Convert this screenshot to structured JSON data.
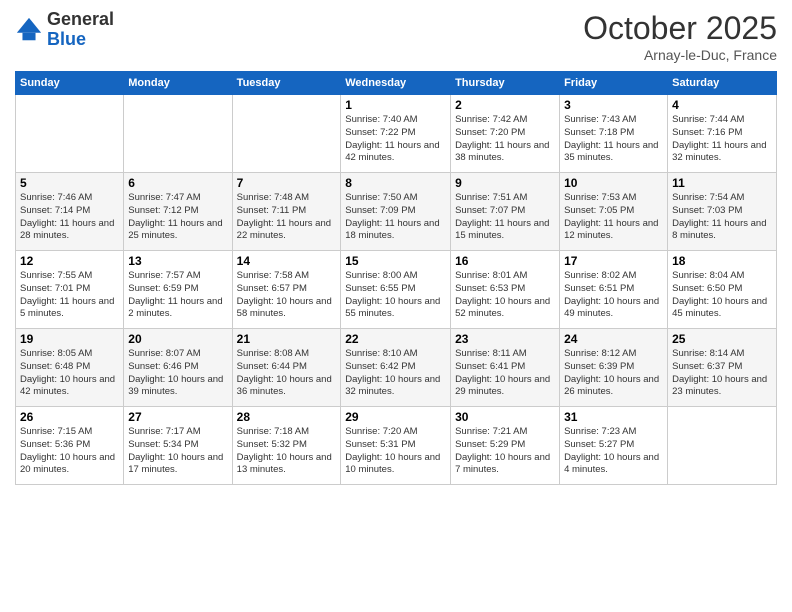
{
  "logo": {
    "general": "General",
    "blue": "Blue"
  },
  "title": "October 2025",
  "location": "Arnay-le-Duc, France",
  "headers": [
    "Sunday",
    "Monday",
    "Tuesday",
    "Wednesday",
    "Thursday",
    "Friday",
    "Saturday"
  ],
  "weeks": [
    [
      {
        "day": "",
        "info": ""
      },
      {
        "day": "",
        "info": ""
      },
      {
        "day": "",
        "info": ""
      },
      {
        "day": "1",
        "info": "Sunrise: 7:40 AM\nSunset: 7:22 PM\nDaylight: 11 hours and 42 minutes."
      },
      {
        "day": "2",
        "info": "Sunrise: 7:42 AM\nSunset: 7:20 PM\nDaylight: 11 hours and 38 minutes."
      },
      {
        "day": "3",
        "info": "Sunrise: 7:43 AM\nSunset: 7:18 PM\nDaylight: 11 hours and 35 minutes."
      },
      {
        "day": "4",
        "info": "Sunrise: 7:44 AM\nSunset: 7:16 PM\nDaylight: 11 hours and 32 minutes."
      }
    ],
    [
      {
        "day": "5",
        "info": "Sunrise: 7:46 AM\nSunset: 7:14 PM\nDaylight: 11 hours and 28 minutes."
      },
      {
        "day": "6",
        "info": "Sunrise: 7:47 AM\nSunset: 7:12 PM\nDaylight: 11 hours and 25 minutes."
      },
      {
        "day": "7",
        "info": "Sunrise: 7:48 AM\nSunset: 7:11 PM\nDaylight: 11 hours and 22 minutes."
      },
      {
        "day": "8",
        "info": "Sunrise: 7:50 AM\nSunset: 7:09 PM\nDaylight: 11 hours and 18 minutes."
      },
      {
        "day": "9",
        "info": "Sunrise: 7:51 AM\nSunset: 7:07 PM\nDaylight: 11 hours and 15 minutes."
      },
      {
        "day": "10",
        "info": "Sunrise: 7:53 AM\nSunset: 7:05 PM\nDaylight: 11 hours and 12 minutes."
      },
      {
        "day": "11",
        "info": "Sunrise: 7:54 AM\nSunset: 7:03 PM\nDaylight: 11 hours and 8 minutes."
      }
    ],
    [
      {
        "day": "12",
        "info": "Sunrise: 7:55 AM\nSunset: 7:01 PM\nDaylight: 11 hours and 5 minutes."
      },
      {
        "day": "13",
        "info": "Sunrise: 7:57 AM\nSunset: 6:59 PM\nDaylight: 11 hours and 2 minutes."
      },
      {
        "day": "14",
        "info": "Sunrise: 7:58 AM\nSunset: 6:57 PM\nDaylight: 10 hours and 58 minutes."
      },
      {
        "day": "15",
        "info": "Sunrise: 8:00 AM\nSunset: 6:55 PM\nDaylight: 10 hours and 55 minutes."
      },
      {
        "day": "16",
        "info": "Sunrise: 8:01 AM\nSunset: 6:53 PM\nDaylight: 10 hours and 52 minutes."
      },
      {
        "day": "17",
        "info": "Sunrise: 8:02 AM\nSunset: 6:51 PM\nDaylight: 10 hours and 49 minutes."
      },
      {
        "day": "18",
        "info": "Sunrise: 8:04 AM\nSunset: 6:50 PM\nDaylight: 10 hours and 45 minutes."
      }
    ],
    [
      {
        "day": "19",
        "info": "Sunrise: 8:05 AM\nSunset: 6:48 PM\nDaylight: 10 hours and 42 minutes."
      },
      {
        "day": "20",
        "info": "Sunrise: 8:07 AM\nSunset: 6:46 PM\nDaylight: 10 hours and 39 minutes."
      },
      {
        "day": "21",
        "info": "Sunrise: 8:08 AM\nSunset: 6:44 PM\nDaylight: 10 hours and 36 minutes."
      },
      {
        "day": "22",
        "info": "Sunrise: 8:10 AM\nSunset: 6:42 PM\nDaylight: 10 hours and 32 minutes."
      },
      {
        "day": "23",
        "info": "Sunrise: 8:11 AM\nSunset: 6:41 PM\nDaylight: 10 hours and 29 minutes."
      },
      {
        "day": "24",
        "info": "Sunrise: 8:12 AM\nSunset: 6:39 PM\nDaylight: 10 hours and 26 minutes."
      },
      {
        "day": "25",
        "info": "Sunrise: 8:14 AM\nSunset: 6:37 PM\nDaylight: 10 hours and 23 minutes."
      }
    ],
    [
      {
        "day": "26",
        "info": "Sunrise: 7:15 AM\nSunset: 5:36 PM\nDaylight: 10 hours and 20 minutes."
      },
      {
        "day": "27",
        "info": "Sunrise: 7:17 AM\nSunset: 5:34 PM\nDaylight: 10 hours and 17 minutes."
      },
      {
        "day": "28",
        "info": "Sunrise: 7:18 AM\nSunset: 5:32 PM\nDaylight: 10 hours and 13 minutes."
      },
      {
        "day": "29",
        "info": "Sunrise: 7:20 AM\nSunset: 5:31 PM\nDaylight: 10 hours and 10 minutes."
      },
      {
        "day": "30",
        "info": "Sunrise: 7:21 AM\nSunset: 5:29 PM\nDaylight: 10 hours and 7 minutes."
      },
      {
        "day": "31",
        "info": "Sunrise: 7:23 AM\nSunset: 5:27 PM\nDaylight: 10 hours and 4 minutes."
      },
      {
        "day": "",
        "info": ""
      }
    ]
  ]
}
